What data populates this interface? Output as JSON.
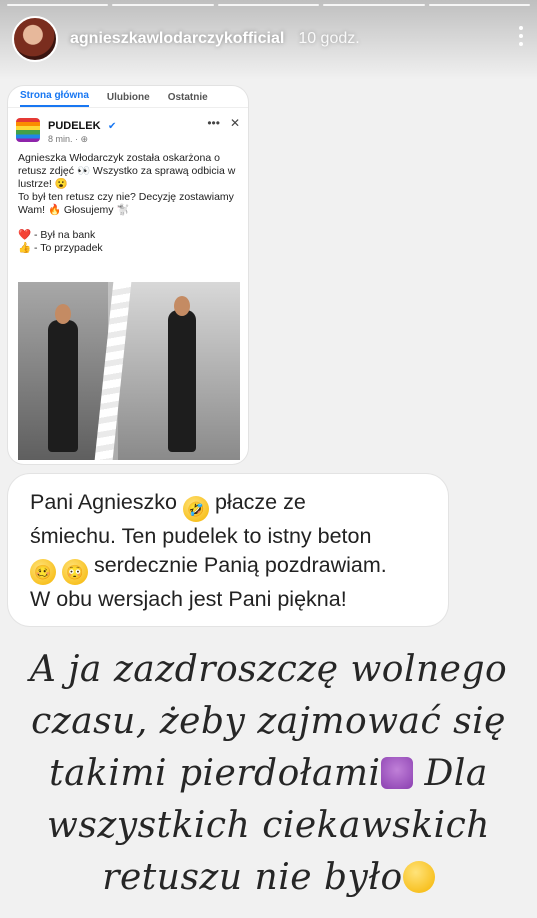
{
  "header": {
    "username": "agnieszkawlodarczykofficial",
    "time_ago": "10 godz."
  },
  "screenshot": {
    "tabs": [
      "Strona główna",
      "Ulubione",
      "Ostatnie"
    ],
    "page_name": "PUDELEK",
    "post_meta": "8 min. · ⊕",
    "text_line1": "Agnieszka Włodarczyk została oskarżona o",
    "text_line2": "retusz zdjęć 👀 Wszystko za sprawą odbicia w",
    "text_line3": "lustrze! 😮",
    "text_line4": "To był ten retusz czy nie? Decyzję zostawiamy",
    "text_line5": "Wam! 🔥 Głosujemy 🐩",
    "option1": "❤️ - Był na bank",
    "option2": "👍 - To przypadek"
  },
  "comment": {
    "part1": "Pani Agnieszko ",
    "emoji1": "🤣",
    "part2": "płacze ze",
    "line2": "śmiechu. Ten pudelek to istny beton",
    "emoji2": "🥴",
    "emoji3": "😳",
    "part3": " serdecznie Panią pozdrawiam.",
    "line4": "W obu wersjach jest Pani piękna!"
  },
  "story_text": {
    "line1": "A ja zazdroszczę  wolnego",
    "line2": "czasu, żeby zajmować się",
    "line3a": "takimi pierdołami",
    "line3b": " Dla",
    "line4": "wszystkich ciekawskich",
    "line5": "retuszu nie było"
  },
  "colors": {
    "background": "#f1f1f1",
    "accent": "#1877f2"
  }
}
